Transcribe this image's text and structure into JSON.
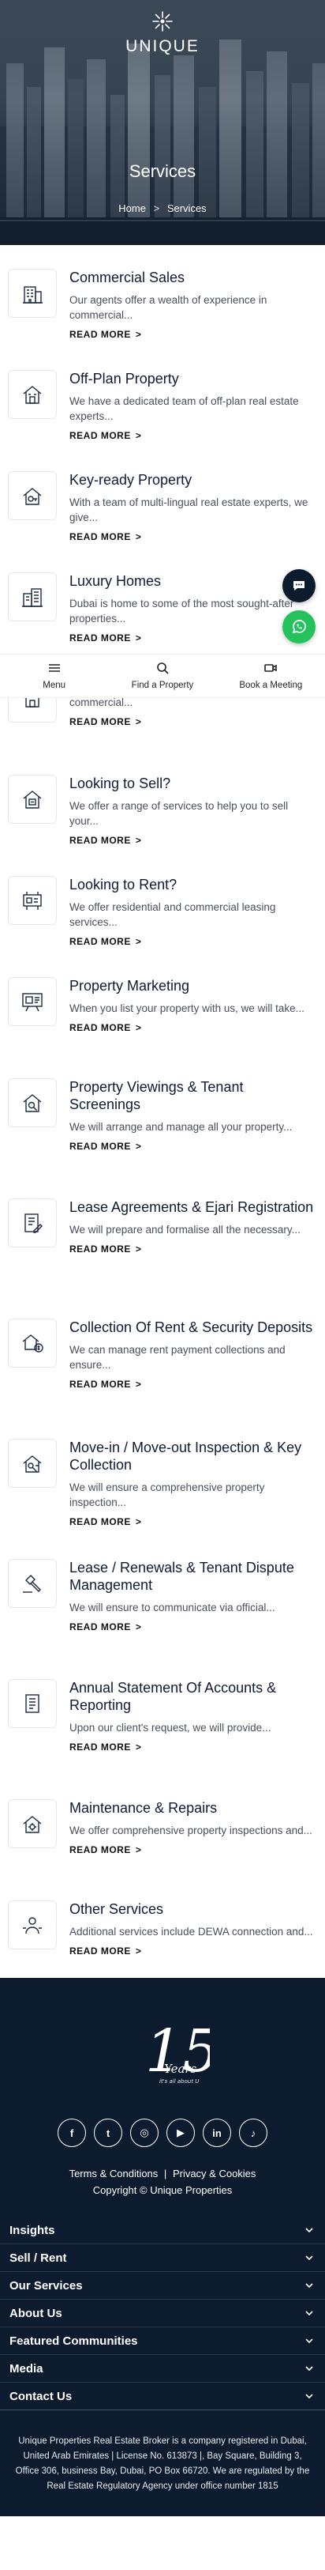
{
  "brand": {
    "name": "UNIQUE"
  },
  "hero": {
    "title": "Services"
  },
  "breadcrumb": {
    "home": "Home",
    "separator": ">",
    "current": "Services"
  },
  "services": [
    {
      "title": "Commercial Sales",
      "desc": "Our agents offer a wealth of experience in commercial...",
      "icon": "commercial-building-icon"
    },
    {
      "title": "Off-Plan Property",
      "desc": "We have a dedicated team of off-plan real estate experts...",
      "icon": "off-plan-house-icon"
    },
    {
      "title": "Key-ready Property",
      "desc": "With a team of multi-lingual real estate experts, we give...",
      "icon": "key-house-icon"
    },
    {
      "title": "Luxury Homes",
      "desc": "Dubai is home to some of the most sought-after properties...",
      "icon": "luxury-homes-icon"
    },
    {
      "title": "",
      "desc": "Our services include off-plan, key-ready and commercial...",
      "icon": "buy-house-icon"
    },
    {
      "title": "Looking to Sell?",
      "desc": "We offer a range of services to help you to sell your...",
      "icon": "sell-house-icon"
    },
    {
      "title": "Looking to Rent?",
      "desc": "We offer residential and commercial leasing services...",
      "icon": "rent-sign-icon"
    },
    {
      "title": "Property Marketing",
      "desc": "When you list your property with us, we will take...",
      "icon": "marketing-board-icon"
    },
    {
      "title": "Property Viewings & Tenant Screenings",
      "desc": "We will arrange and manage all your property...",
      "icon": "viewing-house-icon"
    },
    {
      "title": "Lease Agreements & Ejari Registration",
      "desc": "We will prepare and formalise all the necessary...",
      "icon": "lease-agreement-icon"
    },
    {
      "title": "Collection Of Rent & Security Deposits",
      "desc": "We can manage rent payment collections and ensure...",
      "icon": "rent-collection-icon"
    },
    {
      "title": "Move-in / Move-out Inspection & Key Collection",
      "desc": "We will ensure a comprehensive property inspection...",
      "icon": "inspection-icon"
    },
    {
      "title": "Lease / Renewals & Tenant Dispute Management",
      "desc": "We will ensure to communicate via official...",
      "icon": "gavel-icon"
    },
    {
      "title": "Annual Statement Of Accounts & Reporting",
      "desc": "Upon our client's request, we will provide...",
      "icon": "statement-icon"
    },
    {
      "title": "Maintenance & Repairs",
      "desc": "We offer comprehensive property inspections and...",
      "icon": "maintenance-house-icon"
    },
    {
      "title": "Other Services",
      "desc": "Additional services include DEWA connection and...",
      "icon": "other-services-icon"
    }
  ],
  "read_more_label": "READ MORE",
  "sticky_nav": {
    "menu": "Menu",
    "find": "Find a Property",
    "book": "Book a Meeting"
  },
  "footer": {
    "logo_number": "15",
    "logo_word": "Years",
    "logo_tagline": "it's all about U",
    "socials": [
      "facebook-icon",
      "twitter-icon",
      "instagram-icon",
      "youtube-icon",
      "linkedin-icon",
      "tiktok-icon"
    ],
    "social_glyphs": [
      "f",
      "t",
      "◎",
      "▶",
      "in",
      "♪"
    ],
    "links": [
      "Terms & Conditions",
      "Privacy & Cookies"
    ],
    "link_separator": "|",
    "copyright": "Copyright © Unique Properties",
    "accordion": [
      "Insights",
      "Sell / Rent",
      "Our Services",
      "About Us",
      "Featured Communities",
      "Media",
      "Contact Us"
    ],
    "legal": "Unique Properties Real Estate Broker is a company registered in Dubai, United Arab Emirates | License No. 613873 |, Bay Square, Building 3, Office 306, business Bay, Dubai, PO Box 66720. We are regulated by the Real Estate Regulatory Agency under office number 1815"
  },
  "colors": {
    "navy": "#0c1b2d",
    "whatsapp": "#25c15d",
    "title_text": "#0f1b33"
  }
}
